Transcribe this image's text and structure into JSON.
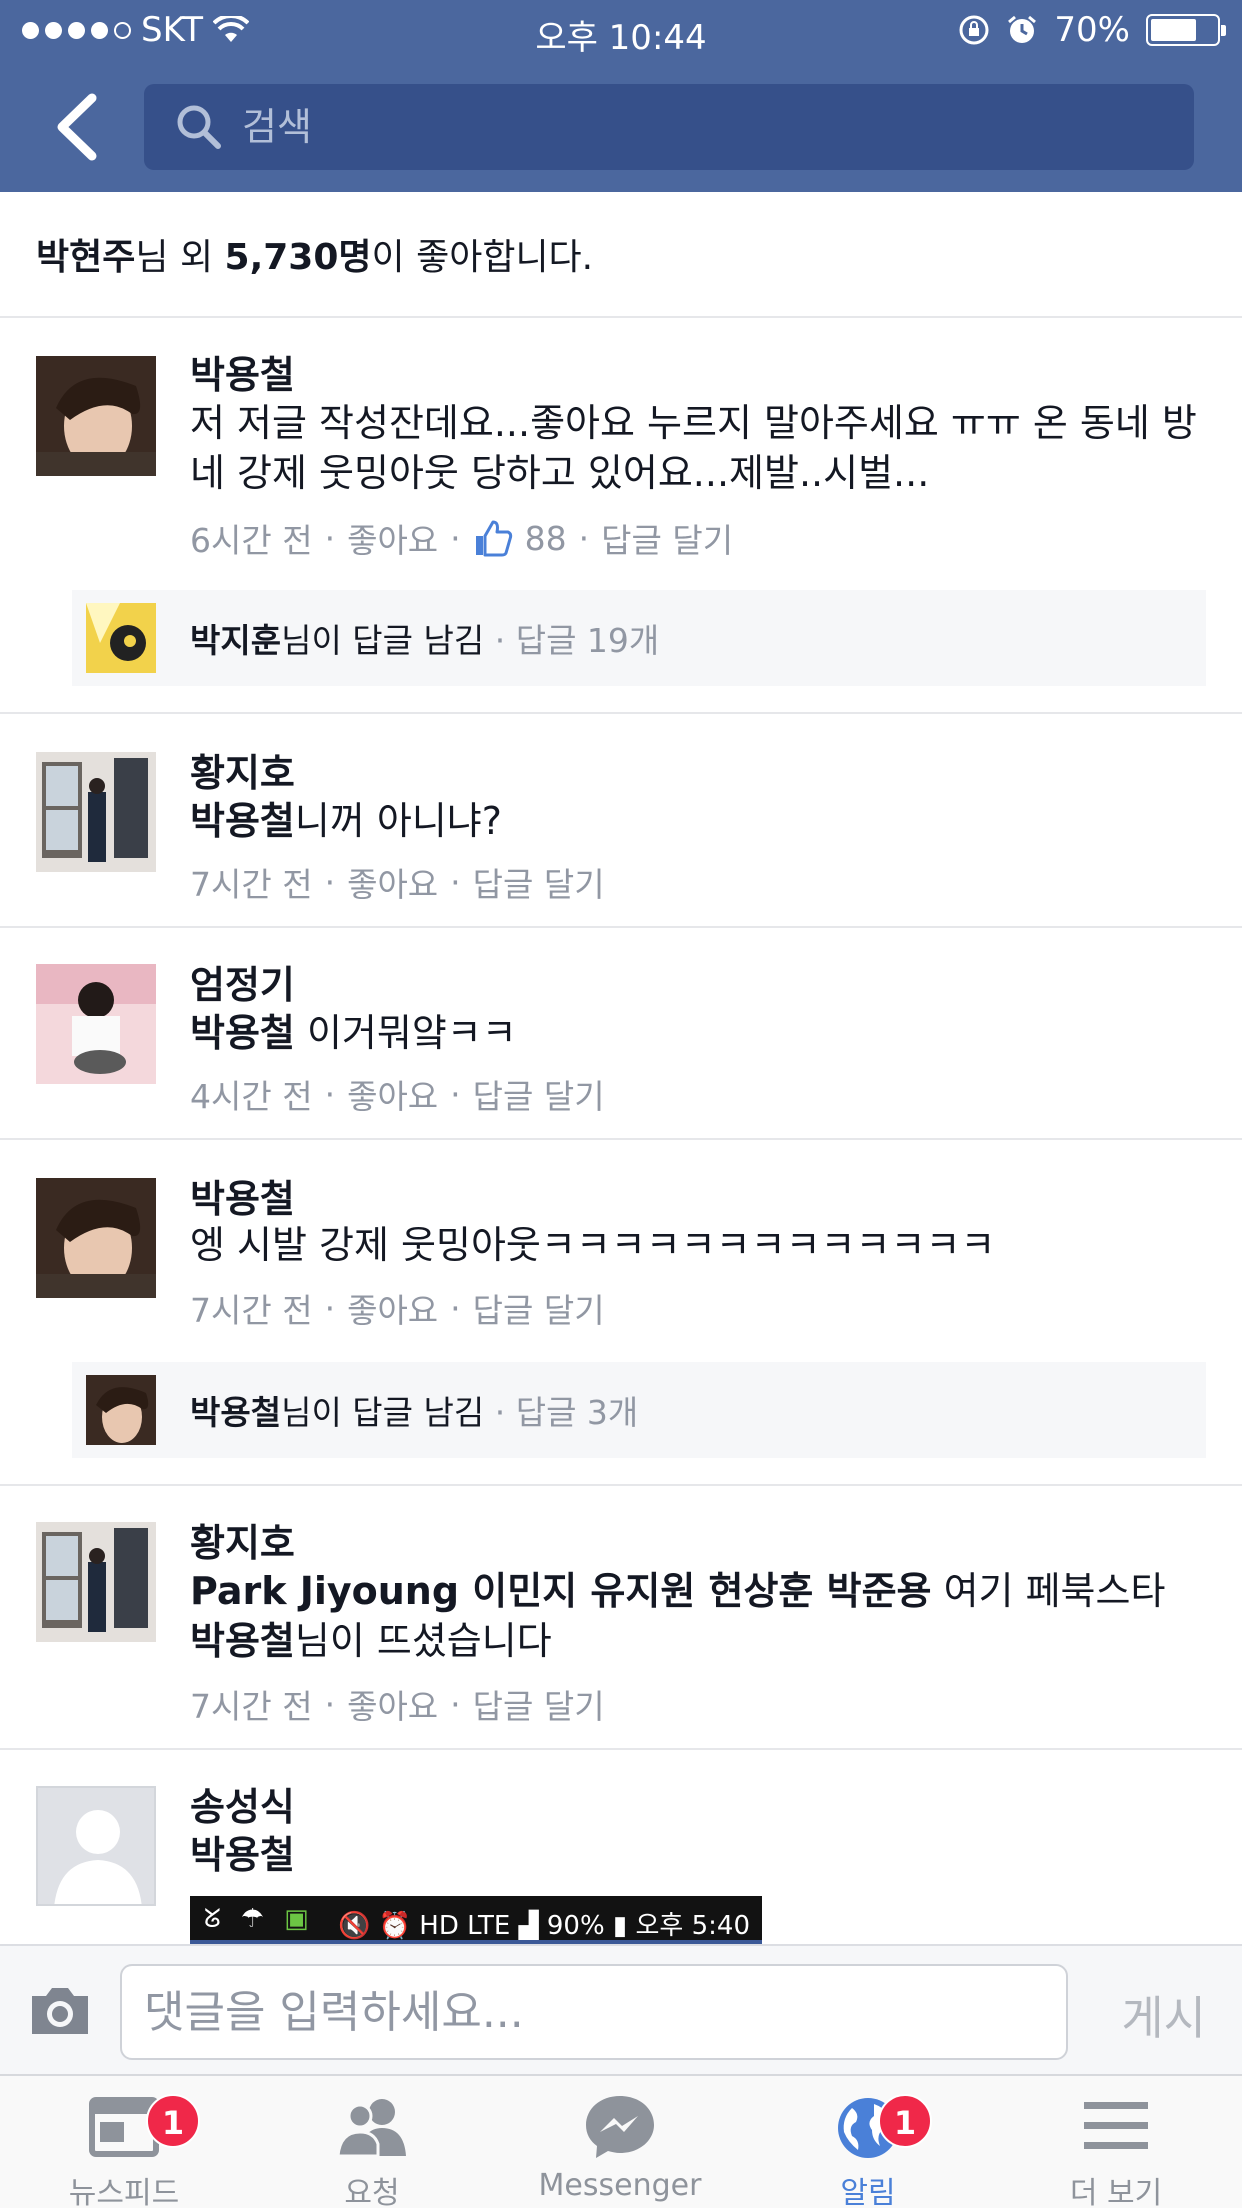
{
  "status_bar": {
    "carrier": "SKT",
    "time": "오후 10:44",
    "battery": "70%",
    "battery_level": 0.7
  },
  "header": {
    "search_placeholder": "검색"
  },
  "likes": {
    "name": "박현주",
    "suffix1": "님 외 ",
    "count": "5,730명",
    "suffix2": "이 좋아합니다."
  },
  "comments": [
    {
      "name": "박용철",
      "text": "저 저글 작성잔데요...좋아요 누르지 말아주세요 ㅠㅠ 온 동네 방네 강제 웃밍아웃 당하고 있어요...제발..시벌...",
      "time": "6시간 전",
      "like": "좋아요",
      "like_count": "88",
      "reply": "답글 달기",
      "replies": {
        "name": "박지훈",
        "action": "님이 답글 남김",
        "count": "· 답글 19개"
      }
    },
    {
      "name": "황지호",
      "mention": "박용철",
      "text": "니꺼 아니냐?",
      "time": "7시간 전",
      "like": "좋아요",
      "reply": "답글 달기"
    },
    {
      "name": "엄정기",
      "mention": "박용철",
      "text": " 이거뭐얔ㅋㅋ",
      "time": "4시간 전",
      "like": "좋아요",
      "reply": "답글 달기"
    },
    {
      "name": "박용철",
      "text": "엥 시발 강제 웃밍아웃ㅋㅋㅋㅋㅋㅋㅋㅋㅋㅋㅋㅋㅋ",
      "time": "7시간 전",
      "like": "좋아요",
      "reply": "답글 달기",
      "replies": {
        "name": "박용철",
        "action": "님이 답글 남김",
        "count": "· 답글 3개"
      }
    },
    {
      "name": "황지호",
      "mention": "Park Jiyoung 이민지 유지원 현상훈 박준용",
      "text": " 여기 페북스타 ",
      "mention2": "박용철",
      "text2": "님이 뜨셨습니다",
      "time": "7시간 전",
      "like": "좋아요",
      "reply": "답글 달기"
    },
    {
      "name": "송성식",
      "mention": "박용철",
      "embedded_status": {
        "battery": "90%",
        "time": "오후 5:40"
      }
    }
  ],
  "composer": {
    "placeholder": "댓글을 입력하세요...",
    "post_label": "게시"
  },
  "tabs": [
    {
      "label": "뉴스피드",
      "icon": "newsfeed-icon",
      "badge": "1"
    },
    {
      "label": "요청",
      "icon": "friend-requests-icon"
    },
    {
      "label": "Messenger",
      "icon": "messenger-icon"
    },
    {
      "label": "알림",
      "icon": "globe-icon",
      "badge": "1",
      "active": true
    },
    {
      "label": "더 보기",
      "icon": "menu-icon"
    }
  ],
  "colors": {
    "header": "#4b679e",
    "accent": "#4a80d8",
    "badge": "#f02849",
    "meta_text": "#9197a3"
  }
}
